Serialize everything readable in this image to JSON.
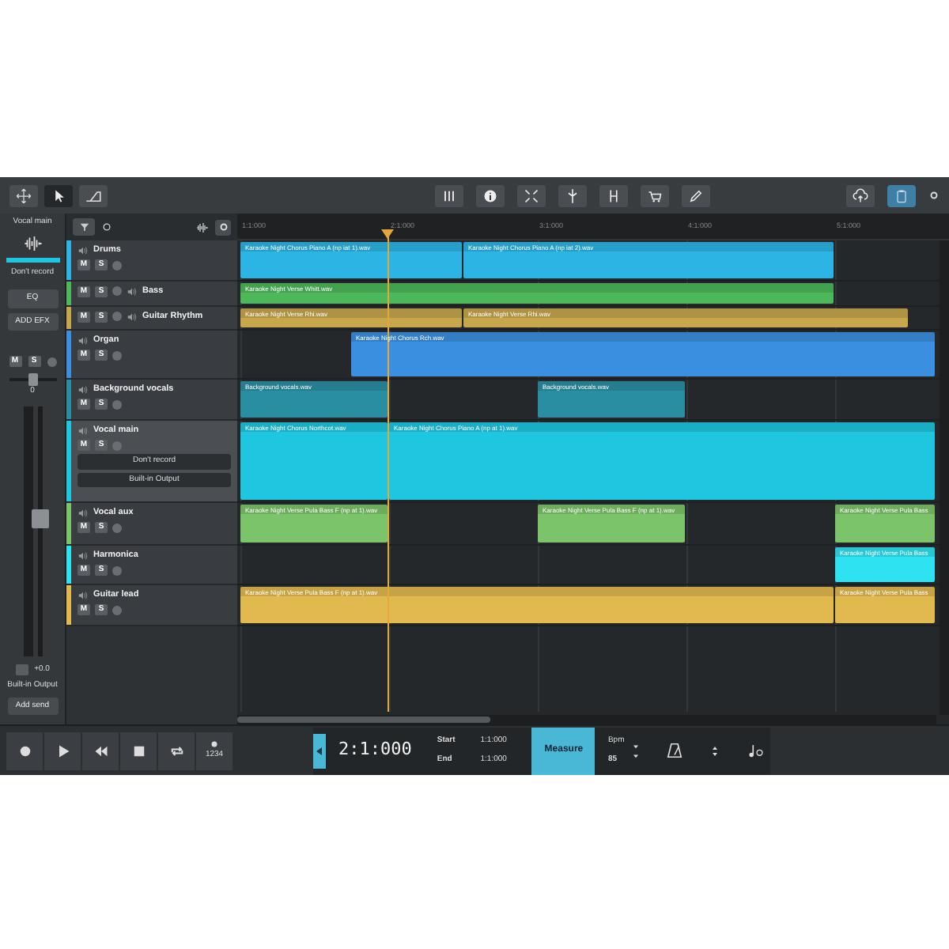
{
  "tools": [
    {
      "selected": false
    },
    {
      "selected": true
    },
    {
      "selected": false
    }
  ],
  "view_toggles": [
    {
      "selected": false
    },
    {
      "selected": true
    }
  ],
  "mixer_strip": {
    "track_name": "Vocal main",
    "record_mode": "Don't record",
    "eq_label": "EQ",
    "add_effects_label": "ADD EFX",
    "mute": "M",
    "solo": "S",
    "pan": {
      "level": 0.5
    },
    "pan_value": "0",
    "fader": {
      "level": 0.55
    },
    "gain_reading": "+0.0",
    "output": "Built-in Output",
    "add_send": "Add send"
  },
  "ruler": [
    "1:1:000",
    "2:1:000",
    "3:1:000",
    "4:1:000",
    "5:1:000"
  ],
  "tracks": [
    {
      "name": "Drums",
      "kind": "standard",
      "color": "#2bb4e4",
      "selected": false,
      "mute": "M",
      "solo": "S",
      "clips": [
        {
          "name": "Karaoke Night Chorus Piano A (np iat 1).wav"
        },
        {
          "name": "Karaoke Night Chorus Piano A (np iat 2).wav"
        }
      ]
    },
    {
      "name": "Bass",
      "kind": "compact",
      "color": "#4cb85a",
      "selected": false,
      "mute": "M",
      "solo": "S",
      "clips": [
        {
          "name": "Karaoke Night Verse Whitt.wav"
        }
      ]
    },
    {
      "name": "Guitar Rhythm",
      "kind": "compact",
      "color": "#c8a64c",
      "selected": false,
      "mute": "M",
      "solo": "S",
      "clips": [
        {
          "name": "Karaoke Night Verse Rhi.wav"
        },
        {
          "name": "Karaoke Night Verse Rhi.wav"
        }
      ]
    },
    {
      "name": "Organ",
      "kind": "standard",
      "color": "#3b8fe0",
      "selected": false,
      "mute": "M",
      "solo": "S",
      "clips": [
        {
          "name": "Karaoke Night Chorus Rch.wav"
        }
      ]
    },
    {
      "name": "Background vocals",
      "kind": "standard",
      "color": "#2a8ea2",
      "selected": false,
      "mute": "M",
      "solo": "S",
      "clips": [
        {
          "name": "Background vocals.wav"
        },
        {
          "name": "Background vocals.wav"
        }
      ]
    },
    {
      "name": "Vocal main",
      "kind": "expanded",
      "color": "#1ec6df",
      "selected": true,
      "mute": "M",
      "solo": "S",
      "record_mode": "Don't record",
      "output": "Built-in Output",
      "clips": [
        {
          "name": "Karaoke Night Chorus Northcot.wav"
        },
        {
          "name": "Karaoke Night Chorus Piano A (np at 1).wav"
        }
      ]
    },
    {
      "name": "Vocal aux",
      "kind": "standard",
      "color": "#7cc46a",
      "selected": false,
      "mute": "M",
      "solo": "S",
      "clips": [
        {
          "name": "Karaoke Night Verse Pula Bass F (np at 1).wav"
        },
        {
          "name": "Karaoke Night Verse Pula Bass F (np at 1).wav"
        },
        {
          "name": "Karaoke Night Verse Pula Bass"
        }
      ]
    },
    {
      "name": "Harmonica",
      "kind": "standard",
      "color": "#2ee2f2",
      "selected": false,
      "mute": "M",
      "solo": "S",
      "clips": [
        {
          "name": "Karaoke Night Verse Pula Bass"
        }
      ]
    },
    {
      "name": "Guitar lead",
      "kind": "standard",
      "color": "#e2b94e",
      "selected": false,
      "mute": "M",
      "solo": "S",
      "clips": [
        {
          "name": "Karaoke Night Verse Pula Bass F (np at 1).wav"
        },
        {
          "name": "Karaoke Night Verse Pula Bass"
        }
      ]
    }
  ],
  "transport": {
    "count_in": "1234",
    "position": "2:1:000",
    "start_label": "Start",
    "start": "1:1:000",
    "end_label": "End",
    "end": "1:1:000",
    "mode": "Measure",
    "bpm_label": "Bpm",
    "bpm": "85"
  }
}
